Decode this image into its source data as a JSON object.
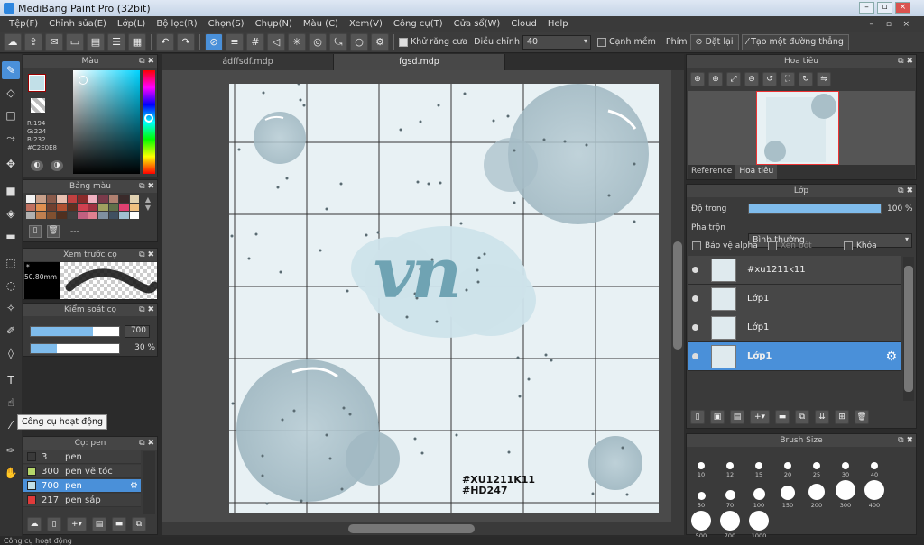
{
  "window": {
    "title": "MediBang Paint Pro (32bit)",
    "controls": [
      "–",
      "▫",
      "×"
    ],
    "inner_controls": [
      "–",
      "▫",
      "×"
    ]
  },
  "menu": [
    "Tệp(F)",
    "Chỉnh sửa(E)",
    "Lớp(L)",
    "Bộ lọc(R)",
    "Chọn(S)",
    "Chụp(N)",
    "Màu (C)",
    "Xem(V)",
    "Công cụ(T)",
    "Cửa sổ(W)",
    "Cloud",
    "Help"
  ],
  "toolbar": {
    "antialias_label": "Khử răng cưa",
    "adjust_label": "Điều chỉnh",
    "adjust_value": "40",
    "soft_edge_label": "Cạnh mềm",
    "key_label": "Phím",
    "reset_label": "Đặt lại",
    "straight_line_label": "Tạo một đường thẳng"
  },
  "color_panel": {
    "title": "Màu",
    "r": "R:194",
    "g": "G:224",
    "b": "B:232",
    "hex": "#C2E0E8",
    "current": "#c2e0e8"
  },
  "palette_panel": {
    "title": "Bảng màu",
    "dashes": "---"
  },
  "brush_preview": {
    "title": "Xem trước cọ",
    "size": "* 50.80mm"
  },
  "brush_control": {
    "title": "Kiểm soát cọ",
    "size_value": "700",
    "opacity_value": "30 %",
    "size_fraction": 0.7,
    "opacity_fraction": 0.3
  },
  "tooltip": "Công cụ hoạt động",
  "brush_list": {
    "title": "Cọ: pen",
    "items": [
      {
        "size": "3",
        "name": "pen",
        "color": "#3a3a3a"
      },
      {
        "size": "300",
        "name": "pen vẽ tóc",
        "color": "#b5d66a"
      },
      {
        "size": "700",
        "name": "pen",
        "color": "#c2e0e8",
        "selected": true
      },
      {
        "size": "217",
        "name": "pen sáp",
        "color": "#e03a3a"
      }
    ]
  },
  "tabs": [
    "ádffsdf.mdp",
    "fgsd.mdp"
  ],
  "navigator": {
    "title": "Hoa tiêu",
    "tab_reference": "Reference",
    "tab_navigator": "Hoa tiêu"
  },
  "layer_panel": {
    "title": "Lớp",
    "opacity_label": "Độ trong",
    "opacity_value": "100 %",
    "opacity_fraction": 1.0,
    "blend_label": "Pha trộn",
    "blend_value": "Bình thường",
    "protect_alpha": "Bảo vệ alpha",
    "clipping": "Xén bớt",
    "lock": "Khóa",
    "layers": [
      {
        "name": "#xu1211k11",
        "selected": false
      },
      {
        "name": "Lớp1",
        "selected": false
      },
      {
        "name": "Lớp1",
        "selected": false
      },
      {
        "name": "Lớp1",
        "selected": true
      }
    ]
  },
  "brush_size_panel": {
    "title": "Brush Size",
    "sizes": [
      "10",
      "12",
      "15",
      "20",
      "25",
      "30",
      "40",
      "50",
      "70",
      "100",
      "150",
      "200",
      "300",
      "400",
      "500",
      "700",
      "1000"
    ]
  },
  "canvas": {
    "lettering": "vn",
    "watermark1": "#XU1211K11",
    "watermark2": "#HD247"
  },
  "status": "Công cụ hoạt động",
  "colors": {
    "accent": "#4a90d9",
    "canvas_bg": "#e8f1f4",
    "bubble": "#a9bfc8",
    "lettering": "#6fa3b3"
  }
}
